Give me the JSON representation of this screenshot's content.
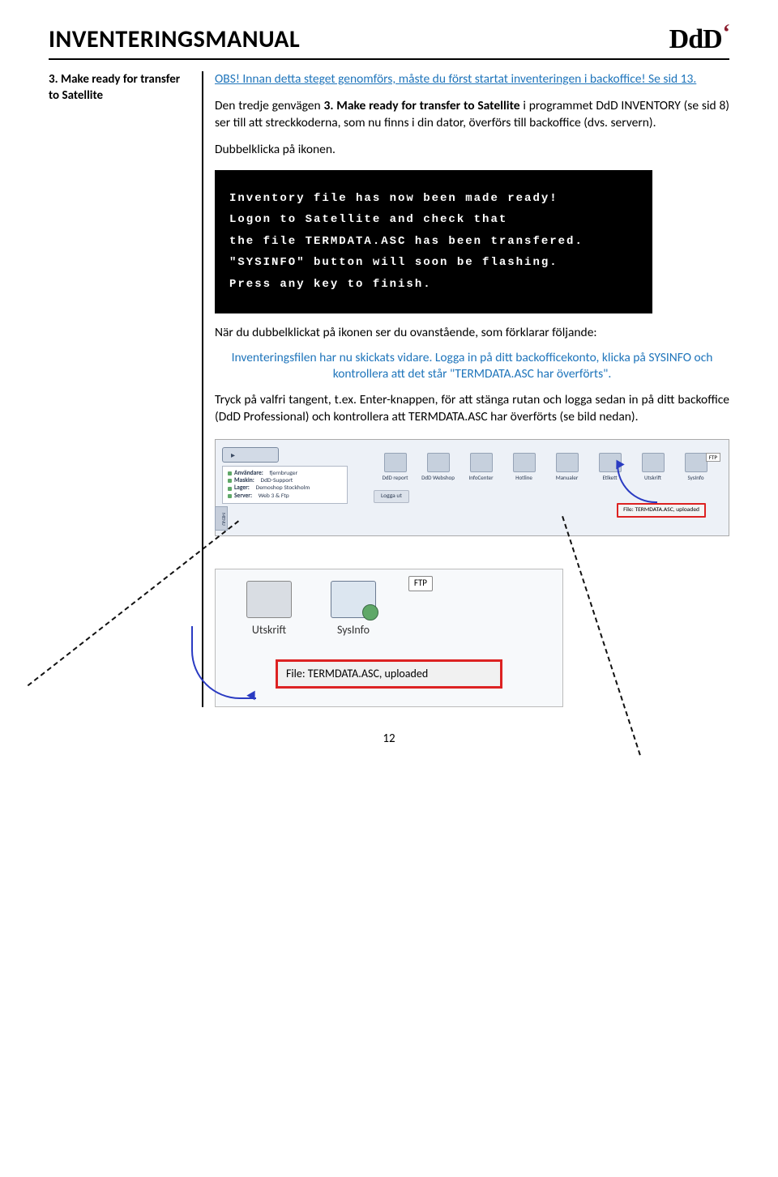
{
  "header": {
    "title": "INVENTERINGSMANUAL",
    "logo": "DdD"
  },
  "left": {
    "step_num": "3.",
    "step_title": "Make ready for transfer to Satellite"
  },
  "right": {
    "obs": "OBS! Innan detta steget genomförs, måste du först startat inventeringen i backoffice! Se sid 13.",
    "p1a": "Den tredje genvägen ",
    "p1b": "3. Make ready for transfer to Satellite",
    "p1c": " i programmet DdD INVENTORY (se sid 8) ser till att streckkoderna, som nu finns i din dator, överförs till backoffice (dvs. servern).",
    "p2": "Dubbelklicka på ikonen.",
    "terminal": {
      "l1": "Inventory file has now been made ready!",
      "l2": "Logon to Satellite and check that",
      "l3": "the file TERMDATA.ASC has been transfered.",
      "l4": "\"SYSINFO\" button will soon be flashing.",
      "l5": "Press any key to finish."
    },
    "p3": "När du dubbelklickat på ikonen ser du ovanstående, som förklarar följande:",
    "blue": "Inventeringsfilen har nu skickats vidare. Logga in på ditt backofficekonto, klicka på SYSINFO och kontrollera att det står \"TERMDATA.ASC har överförts\".",
    "p4": "Tryck på valfri tangent, t.ex. Enter-knappen, för att stänga rutan och logga sedan in på ditt backoffice (DdD Professional) och kontrollera att TERMDATA.ASC har överförts (se bild nedan)."
  },
  "toolbar_sm": {
    "home": "▸",
    "info": {
      "user_label": "Användare:",
      "user_val": "fjernbruger",
      "machine_label": "Maskin:",
      "machine_val": "DdD-Support",
      "store_label": "Lager:",
      "store_val": "Demoshop Stockholm",
      "server_label": "Server:",
      "server_val": "Web 3 & Ftp"
    },
    "buttons": [
      "DdD report",
      "DdD Webshop",
      "InfoCenter",
      "Hotline",
      "Manualer",
      "Etikett",
      "Utskrift",
      "SysInfo"
    ],
    "logout": "Logga ut",
    "file_sm": "File: TERMDATA.ASC, uploaded",
    "ftp": "FTP",
    "menu": "MENU"
  },
  "zoom": {
    "ftp": "FTP",
    "btn1": "Utskrift",
    "btn2": "SysInfo",
    "file": "File: TERMDATA.ASC, uploaded"
  },
  "page": "12"
}
